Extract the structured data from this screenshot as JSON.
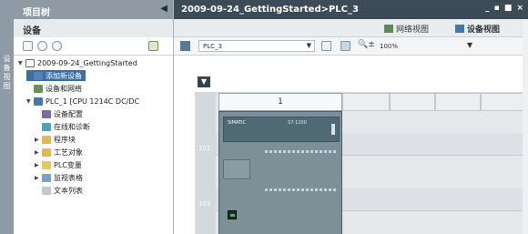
{
  "side_panel": {
    "vertical_label": "设备视图"
  },
  "project_tree": {
    "title": "项目树",
    "collapse_icon": "chevron-left-icon",
    "section_title": "设备",
    "nodes": [
      {
        "label": "2009-09-24_GettingStarted",
        "indent": 0,
        "expander": "▼",
        "icon": "project-icon"
      },
      {
        "label": "添加新设备",
        "indent": 1,
        "expander": "",
        "icon": "add-device-icon",
        "selected": true
      },
      {
        "label": "设备和网络",
        "indent": 1,
        "expander": "",
        "icon": "network-icon"
      },
      {
        "label": "PLC_1 [CPU 1214C DC/DC",
        "indent": 1,
        "expander": "▼",
        "icon": "plc-icon"
      },
      {
        "label": "设备配置",
        "indent": 2,
        "expander": "",
        "icon": "device-config-icon"
      },
      {
        "label": "在线和诊断",
        "indent": 2,
        "expander": "",
        "icon": "diagnostics-icon"
      },
      {
        "label": "程序块",
        "indent": 2,
        "expander": "▶",
        "icon": "folder-icon"
      },
      {
        "label": "工艺对象",
        "indent": 2,
        "expander": "▶",
        "icon": "folder-icon"
      },
      {
        "label": "PLC变量",
        "indent": 2,
        "expander": "▶",
        "icon": "plc-tags-icon"
      },
      {
        "label": "监视表格",
        "indent": 2,
        "expander": "▶",
        "icon": "watch-table-icon"
      },
      {
        "label": "文本列表",
        "indent": 2,
        "expander": "",
        "icon": "text-list-icon"
      }
    ]
  },
  "editor": {
    "title": "2009-09-24_GettingStarted>PLC_3",
    "window_controls": "_ ▪ ■ ×",
    "tabs": {
      "network_view": "网络视图",
      "device_view": "设备视图"
    },
    "device_select": "PLC_3",
    "zoom_value": "100%",
    "zoom_icon": "🔍±",
    "dropdown_arrow": "▼",
    "collapse_arrow": "▼",
    "rack": {
      "slot_header": "1",
      "row_labels": [
        "101",
        "103"
      ],
      "plc_label": "SIMATIC",
      "plc_label2": "S7-1200"
    }
  }
}
